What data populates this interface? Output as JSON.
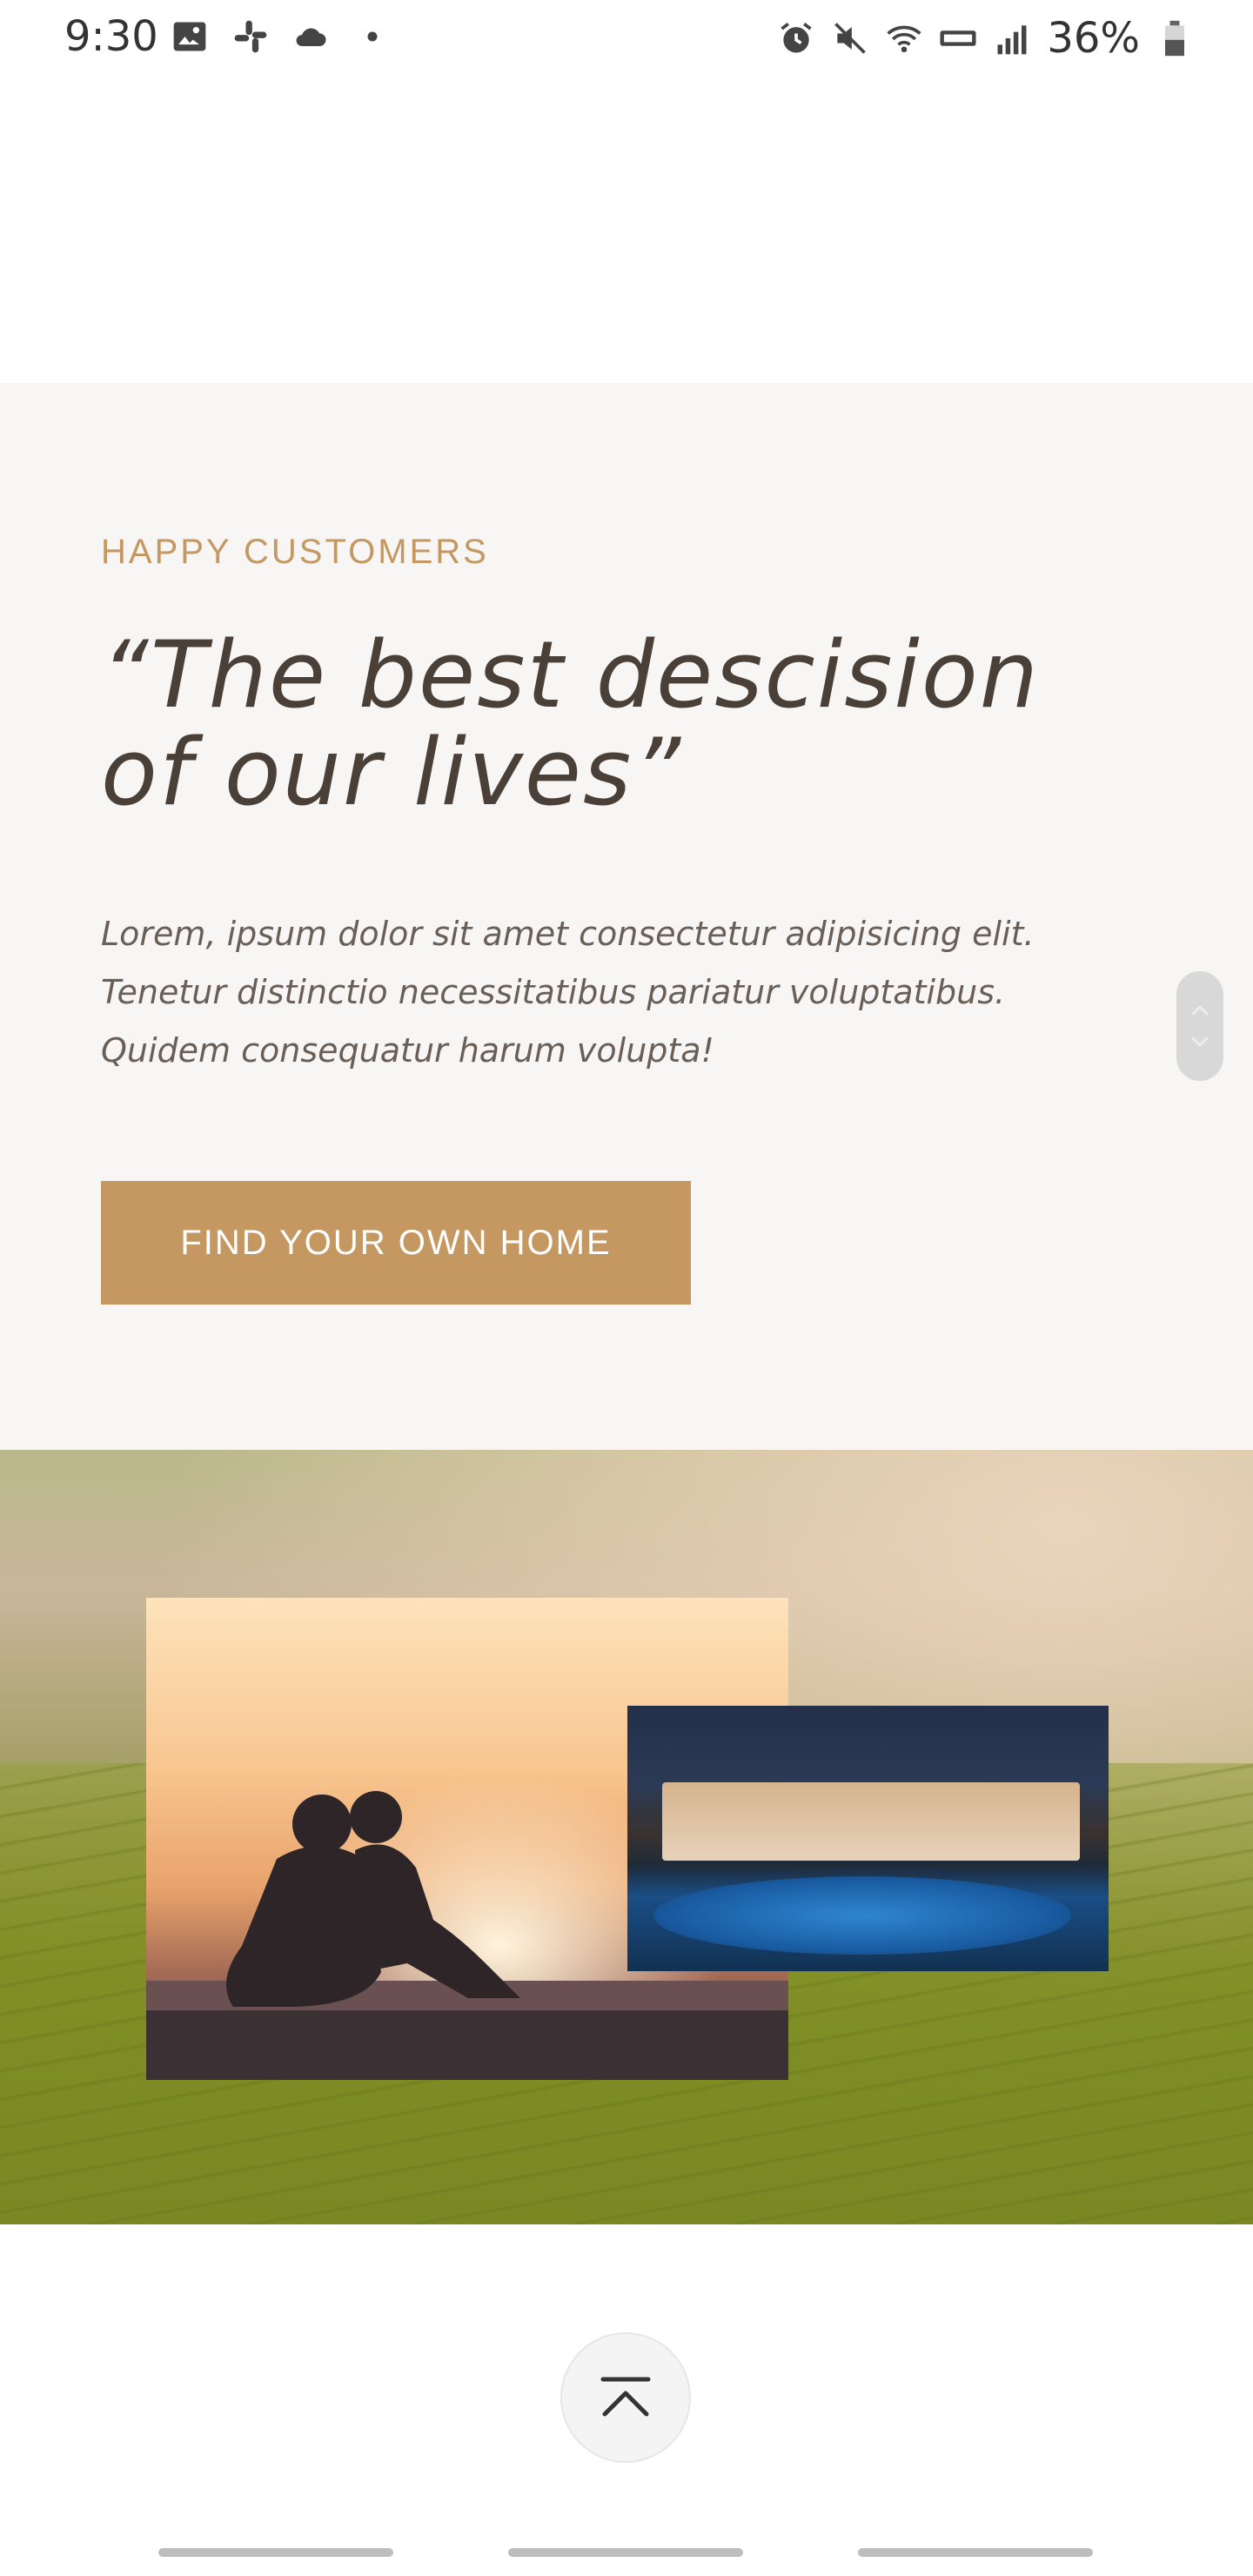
{
  "status_bar": {
    "time": "9:30",
    "battery": "36%",
    "icons_left": [
      "image-icon",
      "slack-icon",
      "cloud-icon",
      "dot-icon"
    ],
    "icons_right": [
      "alarm-icon",
      "mute-icon",
      "wifi-icon",
      "volte-icon",
      "signal-icon",
      "battery-icon"
    ]
  },
  "testimonial": {
    "eyebrow": "HAPPY CUSTOMERS",
    "quote": "“The best descision of our lives”",
    "body": "Lorem, ipsum dolor sit amet consectetur adipisicing elit. Tenetur distinctio necessitatibus pariatur voluptatibus. Quidem consequatur harum volupta!",
    "cta_label": "FIND YOUR OWN HOME",
    "accent_color": "#c59862",
    "background_color": "#f7f6f5"
  },
  "images": {
    "couple_photo": "couple-sunset-image",
    "pool_photo": "villa-pool-image",
    "background": "green-hills-image"
  },
  "controls": {
    "side_scroller": [
      "chevron-up-icon",
      "chevron-down-icon"
    ],
    "back_to_top": "chevron-up-bar-icon"
  }
}
